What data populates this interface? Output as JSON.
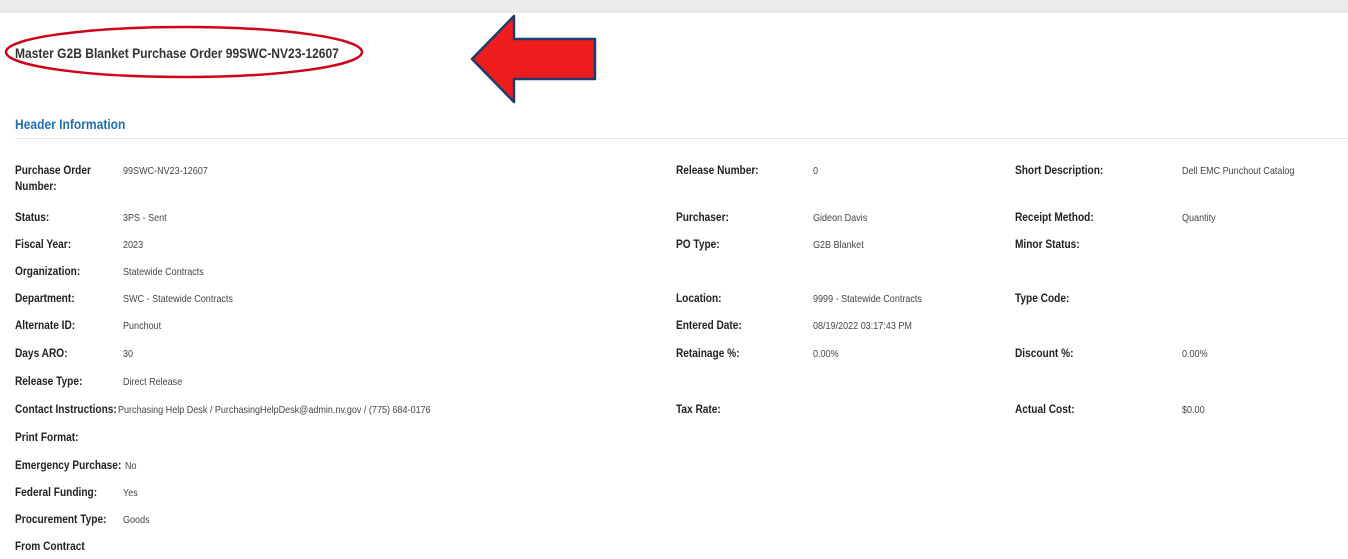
{
  "page": {
    "title": "Master G2B Blanket Purchase Order 99SWC-NV23-12607",
    "section_title": "Header Information"
  },
  "annotations": {
    "ellipse_color": "#d0021b",
    "arrow_fill": "#ee1c1c",
    "arrow_stroke": "#1f3a6b"
  },
  "fields": {
    "po_number": {
      "label": "Purchase Order Number:",
      "value": "99SWC-NV23-12607"
    },
    "release_number": {
      "label": "Release Number:",
      "value": "0"
    },
    "short_description": {
      "label": "Short Description:",
      "value": "Dell EMC Punchout Catalog"
    },
    "status": {
      "label": "Status:",
      "value": "3PS - Sent"
    },
    "purchaser": {
      "label": "Purchaser:",
      "value": "Gideon Davis"
    },
    "receipt_method": {
      "label": "Receipt Method:",
      "value": "Quantity"
    },
    "fiscal_year": {
      "label": "Fiscal Year:",
      "value": "2023"
    },
    "po_type": {
      "label": "PO Type:",
      "value": "G2B Blanket"
    },
    "minor_status": {
      "label": "Minor Status:",
      "value": ""
    },
    "organization": {
      "label": "Organization:",
      "value": "Statewide Contracts"
    },
    "department": {
      "label": "Department:",
      "value": "SWC - Statewide Contracts"
    },
    "location": {
      "label": "Location:",
      "value": "9999 - Statewide Contracts"
    },
    "type_code": {
      "label": "Type Code:",
      "value": ""
    },
    "alternate_id": {
      "label": "Alternate ID:",
      "value": "Punchout"
    },
    "entered_date": {
      "label": "Entered Date:",
      "value": "08/19/2022 03:17:43 PM"
    },
    "days_aro": {
      "label": "Days ARO:",
      "value": "30"
    },
    "retainage": {
      "label": "Retainage %:",
      "value": "0.00%"
    },
    "discount": {
      "label": "Discount %:",
      "value": "0.00%"
    },
    "release_type": {
      "label": "Release Type:",
      "value": "Direct Release"
    },
    "contact_instructions": {
      "label": "Contact Instructions:",
      "value": "Purchasing Help Desk / PurchasingHelpDesk@admin.nv.gov / (775) 684-0176"
    },
    "tax_rate": {
      "label": "Tax Rate:",
      "value": ""
    },
    "actual_cost": {
      "label": "Actual Cost:",
      "value": "$0.00"
    },
    "print_format": {
      "label": "Print Format:",
      "value": ""
    },
    "emergency_purchase": {
      "label": "Emergency Purchase:",
      "value": "No"
    },
    "federal_funding": {
      "label": "Federal Funding:",
      "value": "Yes"
    },
    "procurement_type": {
      "label": "Procurement Type:",
      "value": "Goods"
    },
    "from_contract": {
      "label": "From Contract",
      "value": ""
    }
  }
}
